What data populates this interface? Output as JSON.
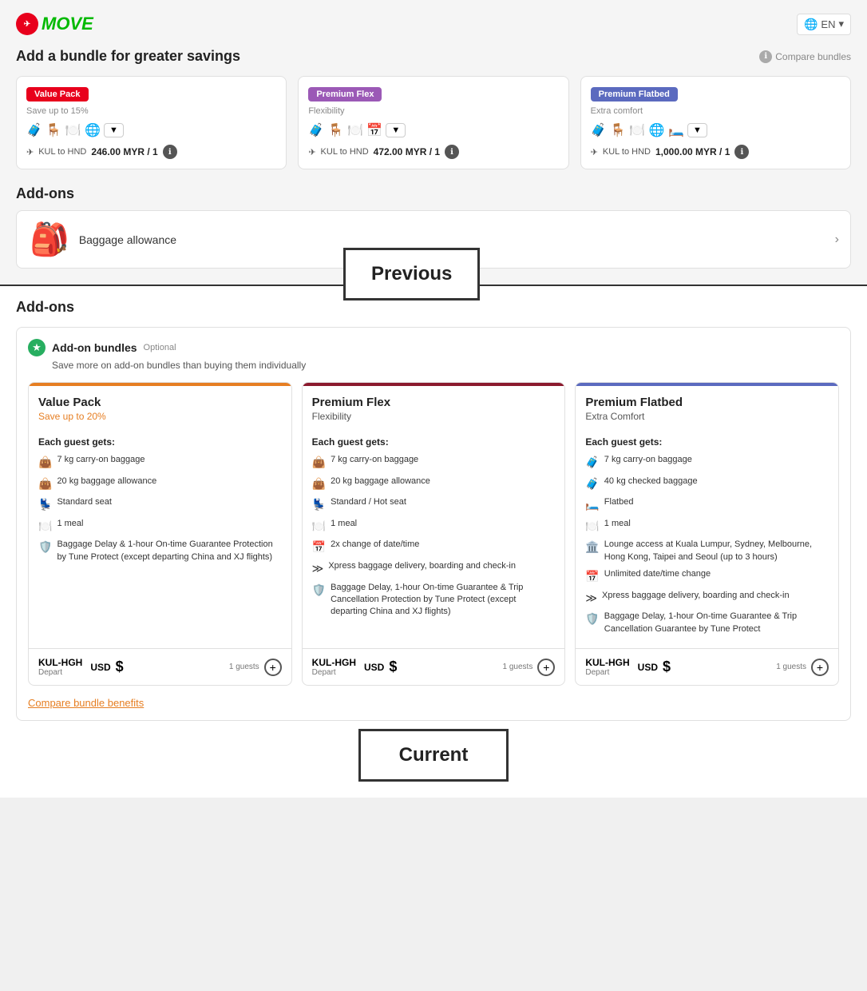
{
  "logo": {
    "badge": "air",
    "text": "MOVe",
    "lang": "EN"
  },
  "top": {
    "bundle_title": "Add a bundle for greater savings",
    "compare_text": "Compare bundles",
    "bundles": [
      {
        "name": "Value Pack",
        "subtitle": "Save up to 15%",
        "badge_class": "badge-red",
        "icons": "🧳 🪑 🍽️ 🌐",
        "route": "KUL to HND",
        "price": "246.00 MYR / 1",
        "dropdown": "▼"
      },
      {
        "name": "Premium Flex",
        "subtitle": "Flexibility",
        "badge_class": "badge-purple",
        "icons": "🧳 🪑 🍽️ 📅",
        "route": "KUL to HND",
        "price": "472.00 MYR / 1",
        "dropdown": "▼"
      },
      {
        "name": "Premium Flatbed",
        "subtitle": "Extra comfort",
        "badge_class": "badge-blue",
        "icons": "🧳 🪑 🍽️ 🌐 🛏️",
        "route": "KUL to HND",
        "price": "1,000.00 MYR / 1",
        "dropdown": "▼"
      }
    ],
    "addons_title": "Add-ons",
    "baggage_text": "Baggage allowance"
  },
  "previous_label": "Previous",
  "bottom": {
    "section_title": "Add-ons",
    "addon_bundles_label": "Add-on bundles",
    "optional_label": "Optional",
    "addon_bundles_subtitle": "Save more on add-on bundles than buying them individually",
    "bundles": [
      {
        "name": "Value Pack",
        "tag": "Save up to 20%",
        "tag_color": "tag-orange",
        "border_class": "col-orange",
        "guest_label": "Each guest gets:",
        "benefits": [
          {
            "icon": "👜",
            "text": "7 kg carry-on baggage"
          },
          {
            "icon": "👜",
            "text": "20 kg baggage allowance"
          },
          {
            "icon": "💺",
            "text": "Standard seat"
          },
          {
            "icon": "🍽️",
            "text": "1 meal"
          },
          {
            "icon": "🛡️",
            "text": "Baggage Delay & 1-hour On-time Guarantee Protection by Tune Protect (except departing China and XJ flights)"
          }
        ],
        "route_code": "KUL-HGH",
        "route_sub": "Depart",
        "currency": "USD",
        "price": "$",
        "guests": "1 guests"
      },
      {
        "name": "Premium Flex",
        "tag": "Flexibility",
        "tag_color": "tag-dark",
        "border_class": "col-darkred",
        "guest_label": "Each guest gets:",
        "benefits": [
          {
            "icon": "👜",
            "text": "7 kg carry-on baggage"
          },
          {
            "icon": "👜",
            "text": "20 kg baggage allowance"
          },
          {
            "icon": "💺",
            "text": "Standard / Hot seat"
          },
          {
            "icon": "🍽️",
            "text": "1 meal"
          },
          {
            "icon": "📅",
            "text": "2x change of date/time"
          },
          {
            "icon": "≫",
            "text": "Xpress baggage delivery, boarding and check-in"
          },
          {
            "icon": "🛡️",
            "text": "Baggage Delay, 1-hour On-time Guarantee & Trip Cancellation Protection by Tune Protect (except departing China and XJ flights)"
          }
        ],
        "route_code": "KUL-HGH",
        "route_sub": "Depart",
        "currency": "USD",
        "price": "$",
        "guests": "1 guests"
      },
      {
        "name": "Premium Flatbed",
        "tag": "Extra Comfort",
        "tag_color": "tag-dark",
        "border_class": "col-darkblue",
        "guest_label": "Each guest gets:",
        "benefits": [
          {
            "icon": "🧳",
            "text": "7 kg carry-on baggage"
          },
          {
            "icon": "🧳",
            "text": "40 kg checked baggage"
          },
          {
            "icon": "🛏️",
            "text": "Flatbed"
          },
          {
            "icon": "🍽️",
            "text": "1 meal"
          },
          {
            "icon": "🏛️",
            "text": "Lounge access at Kuala Lumpur, Sydney, Melbourne, Hong Kong, Taipei and Seoul (up to 3 hours)"
          },
          {
            "icon": "📅",
            "text": "Unlimited date/time change"
          },
          {
            "icon": "≫",
            "text": "Xpress baggage delivery, boarding and check-in"
          },
          {
            "icon": "🛡️",
            "text": "Baggage Delay, 1-hour On-time Guarantee & Trip Cancellation Guarantee by Tune Protect"
          }
        ],
        "route_code": "KUL-HGH",
        "route_sub": "Depart",
        "currency": "USD",
        "price": "$",
        "guests": "1 guests"
      }
    ],
    "compare_benefits_text": "Compare bundle benefits"
  },
  "current_label": "Current"
}
